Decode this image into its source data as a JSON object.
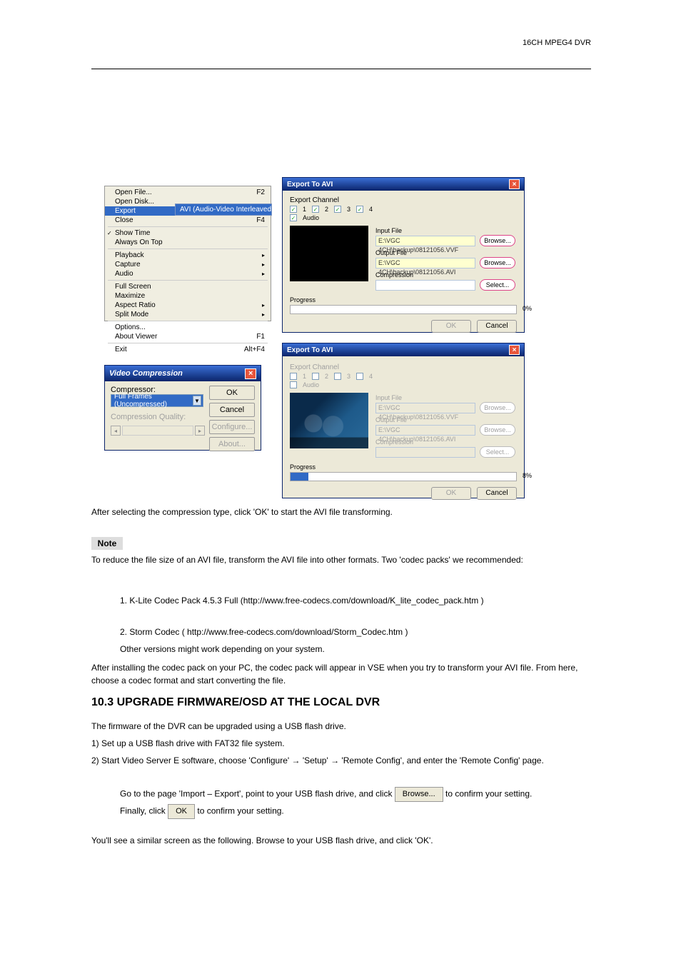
{
  "page": {
    "header_right": "16CH MPEG4 DVR"
  },
  "menu": {
    "items": [
      {
        "label": "Open File...",
        "accel": "F2"
      },
      {
        "label": "Open Disk..."
      },
      {
        "label": "Export",
        "accel": "▸",
        "hl": true
      },
      {
        "label": "Close",
        "accel": "F4"
      }
    ],
    "group2": [
      {
        "label": "Show Time",
        "check": true
      },
      {
        "label": "Always On Top"
      }
    ],
    "group3": [
      {
        "label": "Playback",
        "accel": "▸"
      },
      {
        "label": "Capture",
        "accel": "▸"
      },
      {
        "label": "Audio",
        "accel": "▸"
      }
    ],
    "group4": [
      {
        "label": "Full Screen"
      },
      {
        "label": "Maximize"
      },
      {
        "label": "Aspect Ratio",
        "accel": "▸"
      },
      {
        "label": "Split Mode",
        "accel": "▸"
      }
    ],
    "group5": [
      {
        "label": "Options..."
      },
      {
        "label": "About Viewer",
        "accel": "F1"
      }
    ],
    "group6": [
      {
        "label": "Exit",
        "accel": "Alt+F4"
      }
    ],
    "submenu": "AVI (Audio-Video Interleaved Files)"
  },
  "vc": {
    "title": "Video Compression",
    "compressor_label": "Compressor:",
    "compressor_value": "Full Frames (Uncompressed)",
    "quality_label": "Compression Quality:",
    "ok": "OK",
    "cancel": "Cancel",
    "configure": "Configure...",
    "about": "About..."
  },
  "exp": {
    "title": "Export To AVI",
    "export_channel": "Export Channel",
    "ch1": "1",
    "ch2": "2",
    "ch3": "3",
    "ch4": "4",
    "audio": "Audio",
    "input_file": "Input File",
    "output_file": "Output File",
    "compression": "Compression",
    "browse": "Browse...",
    "select": "Select...",
    "progress": "Progress",
    "pct0": "0%",
    "pct8": "8%",
    "ok": "OK",
    "cancel": "Cancel",
    "path_in": "E:\\VGC 4CH\\backup\\08121056.VVF",
    "path_out": "E:\\VGC 4CH\\backup\\08121056.AVI"
  },
  "txt": {
    "t1": "After selecting the compression type, click 'OK' to start the AVI file transforming.",
    "note": "Note",
    "t2": "To reduce the file size of an AVI file, transform the AVI file into other formats. Two 'codec packs' we recommended:",
    "t3a": "1. ",
    "t3b": "K-Lite Codec Pack 4.5.3 Full (",
    "t3c": "http://www.free-codecs.com/download/K_lite_codec_pack.htm",
    "t3d": " )",
    "t4": "2. Storm Codec ( http://www.free-codecs.com/download/Storm_Codec.htm )",
    "t5": "Other versions might work depending on your system.",
    "t6": "After installing the codec pack on your PC, the codec pack will appear in VSE when you try to transform your AVI file. From here, choose a codec format and start converting the file.",
    "heading": "10.3 UPGRADE FIRMWARE/OSD AT THE LOCAL DVR",
    "t7": "The firmware of the DVR can be upgraded using a USB flash drive.",
    "t8": "1) Set up a USB flash drive with FAT32 file system.",
    "t9": "2) Start Video Server E software, choose 'Configure' → 'Setup' → 'Remote Config', and enter the 'Remote Config' page.",
    "t10": "Go to the page 'Import – Export', point to your USB flash drive, and click ",
    "t10b": " to confirm your setting.",
    "t11": "Finally, click ",
    "t11b": " to confirm your setting.",
    "t12": "You'll see a similar screen as the following. Browse to your USB flash drive, and click 'OK'.",
    "browse_btn": "Browse...",
    "ok_btn": "OK"
  }
}
